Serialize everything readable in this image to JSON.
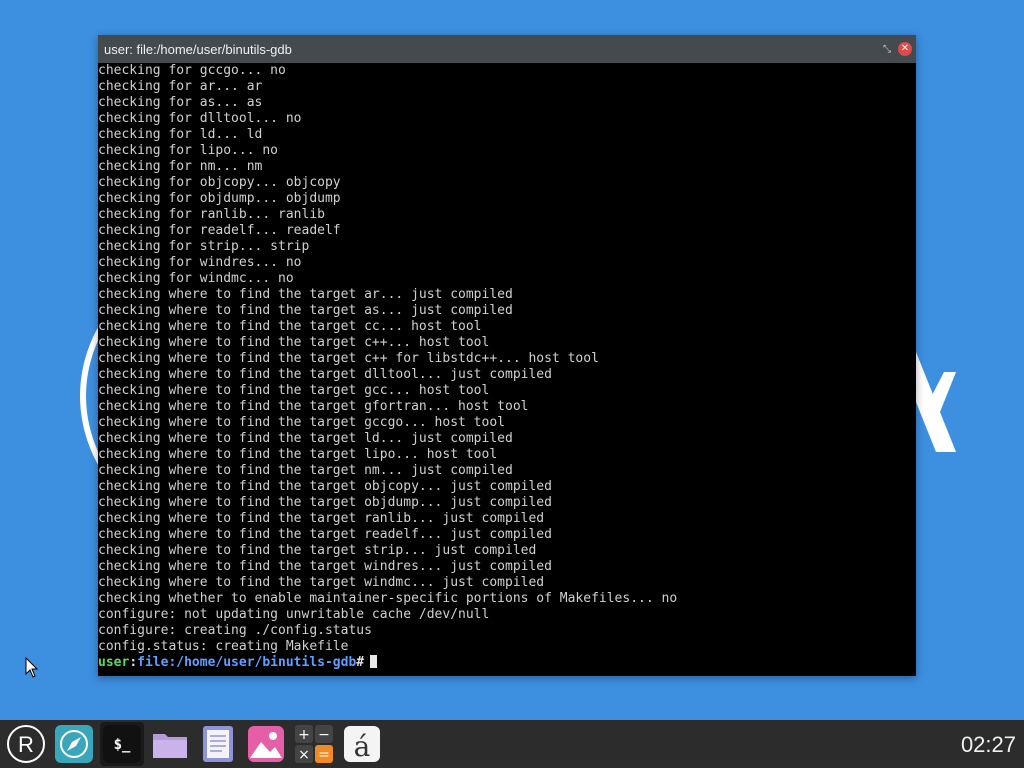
{
  "window": {
    "title": "user: file:/home/user/binutils-gdb",
    "restore_glyph": "⤡",
    "close_glyph": "✕"
  },
  "terminal": {
    "lines": [
      "checking for gccgo... no",
      "checking for ar... ar",
      "checking for as... as",
      "checking for dlltool... no",
      "checking for ld... ld",
      "checking for lipo... no",
      "checking for nm... nm",
      "checking for objcopy... objcopy",
      "checking for objdump... objdump",
      "checking for ranlib... ranlib",
      "checking for readelf... readelf",
      "checking for strip... strip",
      "checking for windres... no",
      "checking for windmc... no",
      "checking where to find the target ar... just compiled",
      "checking where to find the target as... just compiled",
      "checking where to find the target cc... host tool",
      "checking where to find the target c++... host tool",
      "checking where to find the target c++ for libstdc++... host tool",
      "checking where to find the target dlltool... just compiled",
      "checking where to find the target gcc... host tool",
      "checking where to find the target gfortran... host tool",
      "checking where to find the target gccgo... host tool",
      "checking where to find the target ld... just compiled",
      "checking where to find the target lipo... host tool",
      "checking where to find the target nm... just compiled",
      "checking where to find the target objcopy... just compiled",
      "checking where to find the target objdump... just compiled",
      "checking where to find the target ranlib... just compiled",
      "checking where to find the target readelf... just compiled",
      "checking where to find the target strip... just compiled",
      "checking where to find the target windres... just compiled",
      "checking where to find the target windmc... just compiled",
      "checking whether to enable maintainer-specific portions of Makefiles... no",
      "configure: not updating unwritable cache /dev/null",
      "configure: creating ./config.status",
      "config.status: creating Makefile"
    ],
    "prompt": {
      "user": "user",
      "sep": ":",
      "path": "file:/home/user/binutils-gdb",
      "symbol": "#"
    }
  },
  "taskbar": {
    "items": [
      {
        "name": "start-menu-icon",
        "glyph": "R"
      },
      {
        "name": "browser-icon",
        "glyph": "⊘"
      },
      {
        "name": "terminal-icon",
        "glyph": "$_"
      },
      {
        "name": "file-manager-icon",
        "glyph": ""
      },
      {
        "name": "text-editor-icon",
        "glyph": ""
      },
      {
        "name": "image-viewer-icon",
        "glyph": ""
      },
      {
        "name": "calculator-icon",
        "glyph": ""
      },
      {
        "name": "character-map-icon",
        "glyph": "á"
      }
    ],
    "clock": "02:27"
  },
  "colors": {
    "desktop": "#3d8fe0",
    "titlebar": "#454a4f",
    "terminal_bg": "#000000",
    "prompt_user": "#5fd75f",
    "prompt_path": "#5f9fff",
    "taskbar": "#2c2c2c"
  }
}
